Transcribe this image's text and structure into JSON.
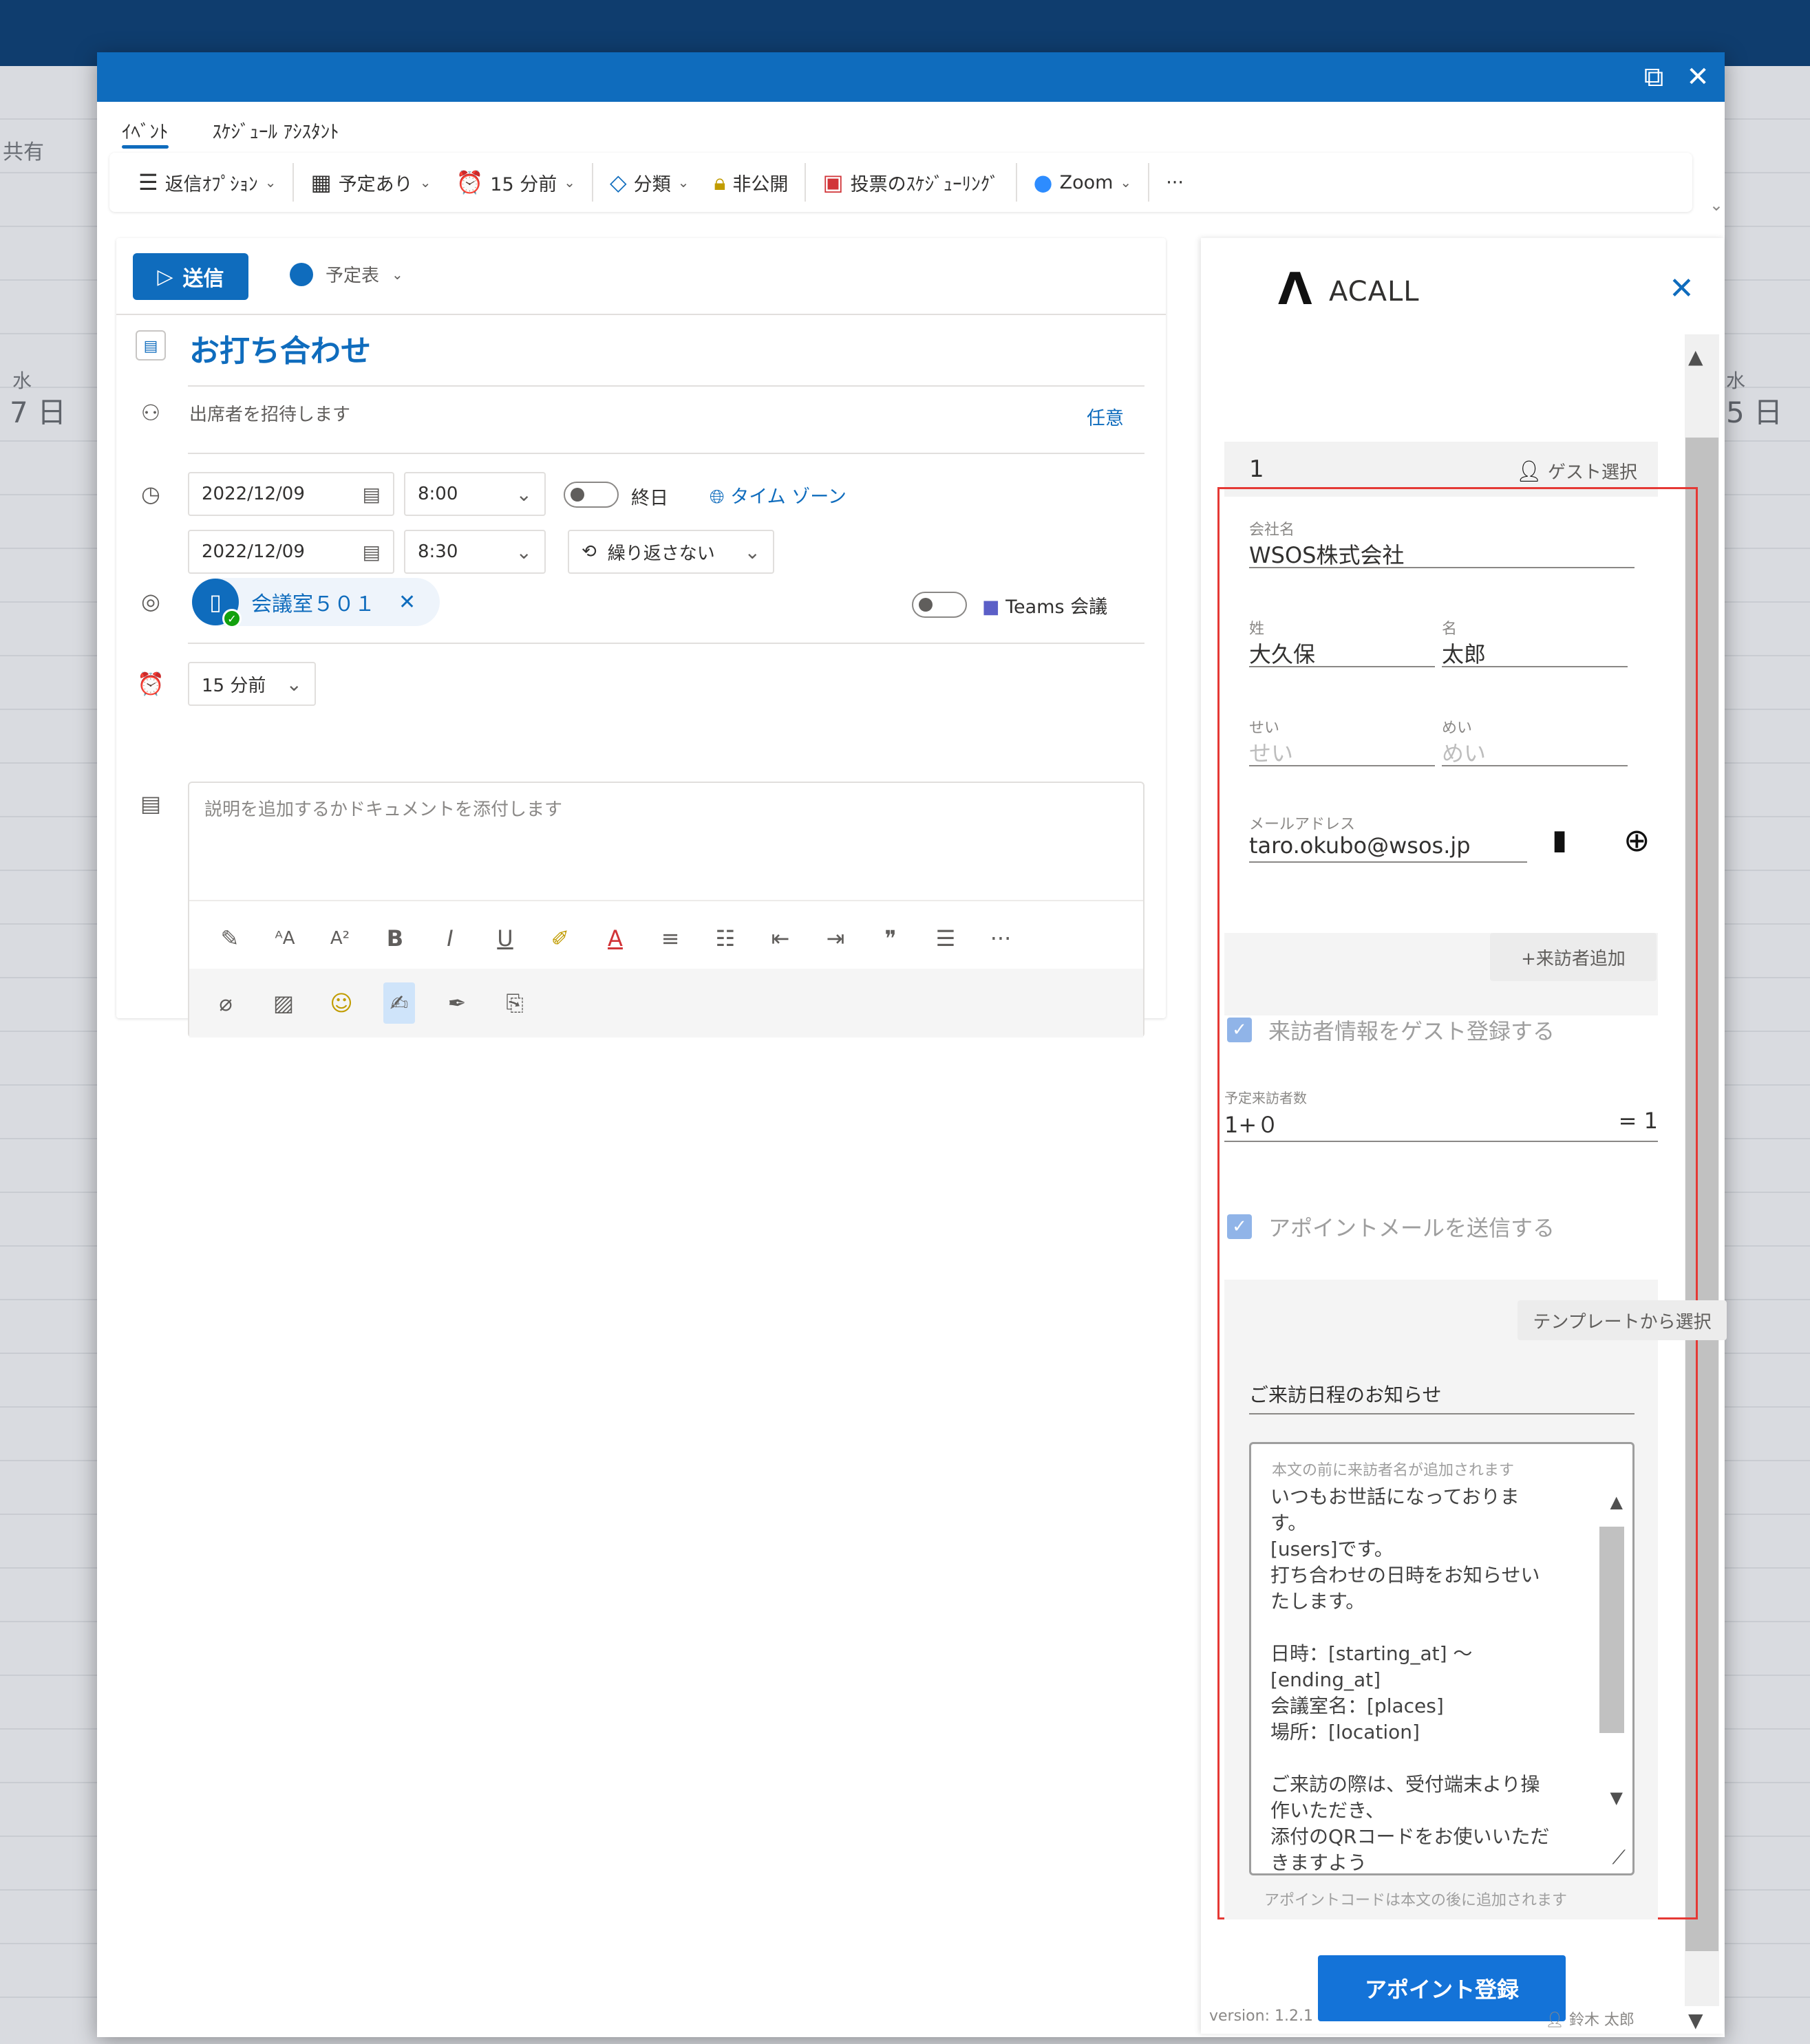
{
  "background": {
    "share_label": "共有",
    "day_left_weekday": "水",
    "day_left_date": "7 日",
    "day_right_weekday": "水",
    "day_right_date": "5 日"
  },
  "window": {
    "popout_icon": "popout-icon",
    "close_icon": "close-icon"
  },
  "tabs": [
    {
      "label": "ｲﾍﾞﾝﾄ",
      "active": true
    },
    {
      "label": "ｽｹｼﾞｭｰﾙ ｱｼｽﾀﾝﾄ",
      "active": false
    }
  ],
  "toolbar": {
    "reply_options": "返信ｵﾌﾟｼｮﾝ",
    "busy": "予定あり",
    "reminder": "15 分前",
    "category": "分類",
    "private": "非公開",
    "poll": "投票のｽｹｼﾞｭｰﾘﾝｸﾞ",
    "zoom": "Zoom",
    "more": "···"
  },
  "event": {
    "send_label": "送信",
    "calendar_label": "予定表",
    "title": "お打ち合わせ",
    "attendees_placeholder": "出席者を招待します",
    "optional_label": "任意",
    "start_date": "2022/12/09",
    "start_time": "8:00",
    "end_date": "2022/12/09",
    "end_time": "8:30",
    "all_day_label": "終日",
    "timezone_label": "タイム ゾーン",
    "repeat_label": "繰り返さない",
    "room_name": "会議室５０１",
    "teams_label": "Teams 会議",
    "reminder_value": "15 分前",
    "description_placeholder": "説明を追加するかドキュメントを添付します"
  },
  "acall": {
    "logo": "Λ",
    "brand": "ACALL",
    "guest_count": "1",
    "guest_select": "ゲスト選択",
    "company_label": "会社名",
    "company_value": "WSOS株式会社",
    "last_name_label": "姓",
    "last_name_value": "大久保",
    "first_name_label": "名",
    "first_name_value": "太郎",
    "last_kana_label": "せい",
    "last_kana_placeholder": "せい",
    "first_kana_label": "めい",
    "first_kana_placeholder": "めい",
    "email_label": "メールアドレス",
    "email_value": "taro.okubo@wsos.jp",
    "add_visitor": "+来訪者追加",
    "register_guest_label": "来訪者情報をゲスト登録する",
    "planned_visitors_label": "予定来訪者数",
    "planned_visitors_expr": "1+０",
    "planned_visitors_total": "= 1",
    "send_mail_label": "アポイントメールを送信する",
    "template_button": "テンプレートから選択",
    "mail_subject": "ご来訪日程のお知らせ",
    "mail_body_note": "本文の前に来訪者名が追加されます",
    "mail_body_lines": [
      "いつもお世話になっておりま",
      "す。",
      "[users]です。",
      "打ち合わせの日時をお知らせい",
      "たします。",
      "",
      "日時：[starting_at] ～",
      "[ending_at]",
      "会議室名：[places]",
      "場所：[location]",
      "",
      "ご来訪の際は、受付端末より操",
      "作いただき、",
      "添付のQRコードをお使いいただ",
      "きますよう"
    ],
    "appoint_code_note": "アポイントコードは本文の後に追加されます",
    "register_button": "アポイント登録",
    "version": "version: 1.2.1",
    "user": "鈴木 太郎"
  }
}
